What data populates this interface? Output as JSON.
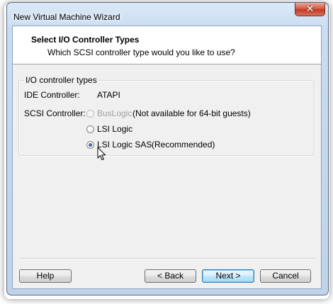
{
  "window": {
    "title": "New Virtual Machine Wizard",
    "close_symbol": "✕"
  },
  "header": {
    "title": "Select I/O Controller Types",
    "subtitle": "Which SCSI controller type would you like to use?"
  },
  "group": {
    "legend": "I/O controller types",
    "ide_label": "IDE Controller:",
    "ide_value": "ATAPI",
    "scsi_label": "SCSI Controller:",
    "options": [
      {
        "label": "BusLogic",
        "note": "(Not available for 64-bit guests)",
        "enabled": false,
        "selected": false
      },
      {
        "label": "LSI Logic",
        "note": "",
        "enabled": true,
        "selected": false
      },
      {
        "label": "LSI Logic SAS",
        "note": "(Recommended)",
        "enabled": true,
        "selected": true
      }
    ]
  },
  "buttons": {
    "help": "Help",
    "back": "< Back",
    "next": "Next >",
    "cancel": "Cancel"
  },
  "icons": {
    "close": "close-icon",
    "cursor": "mouse-pointer-icon"
  }
}
